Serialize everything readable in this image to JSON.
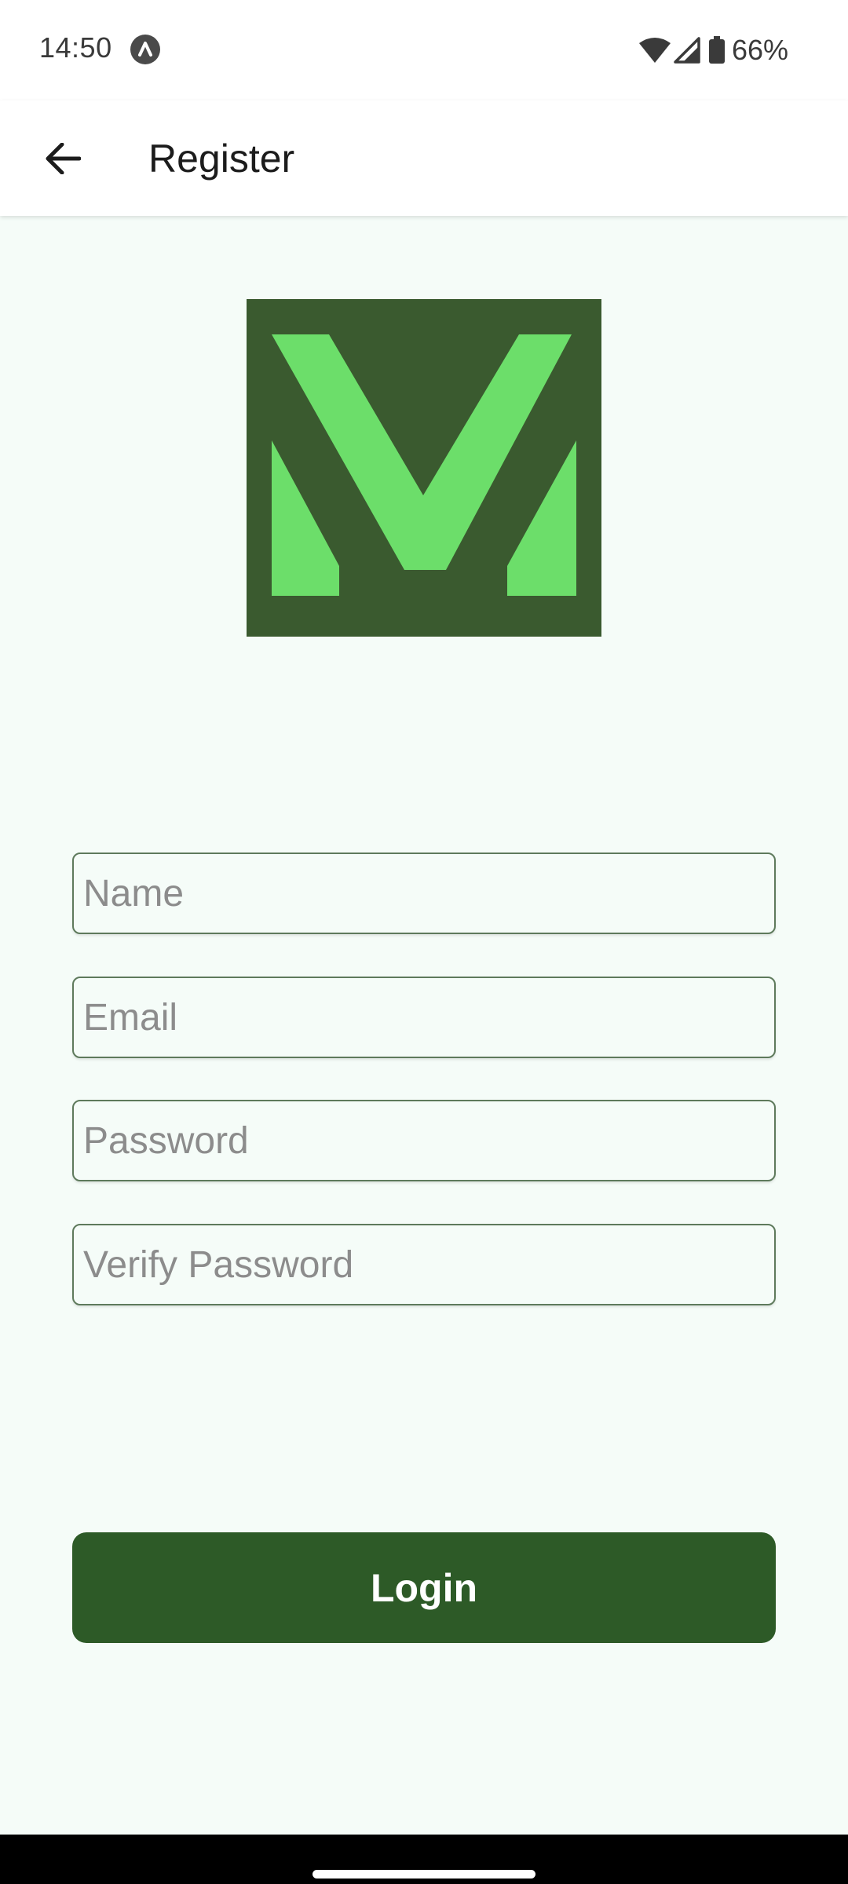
{
  "status_bar": {
    "time": "14:50",
    "notification_icon": "a-letter-circle-icon",
    "wifi_icon": "wifi-icon",
    "signal_icon": "cell-signal-icon",
    "battery_icon": "battery-icon",
    "battery_percent": "66%"
  },
  "app_bar": {
    "back_icon": "arrow-back-icon",
    "title": "Register"
  },
  "logo": {
    "icon": "v-letter-logo",
    "background_color": "#3a5a2f",
    "letter_color": "#6cde6a"
  },
  "form": {
    "name_placeholder": "Name",
    "name_value": "",
    "email_placeholder": "Email",
    "email_value": "",
    "password_placeholder": "Password",
    "password_value": "",
    "verify_password_placeholder": "Verify Password",
    "verify_password_value": ""
  },
  "actions": {
    "login_label": "Login"
  },
  "colors": {
    "accent": "#2d5a27",
    "page_background": "#f5fcf8",
    "field_border": "#5e7a5c"
  }
}
